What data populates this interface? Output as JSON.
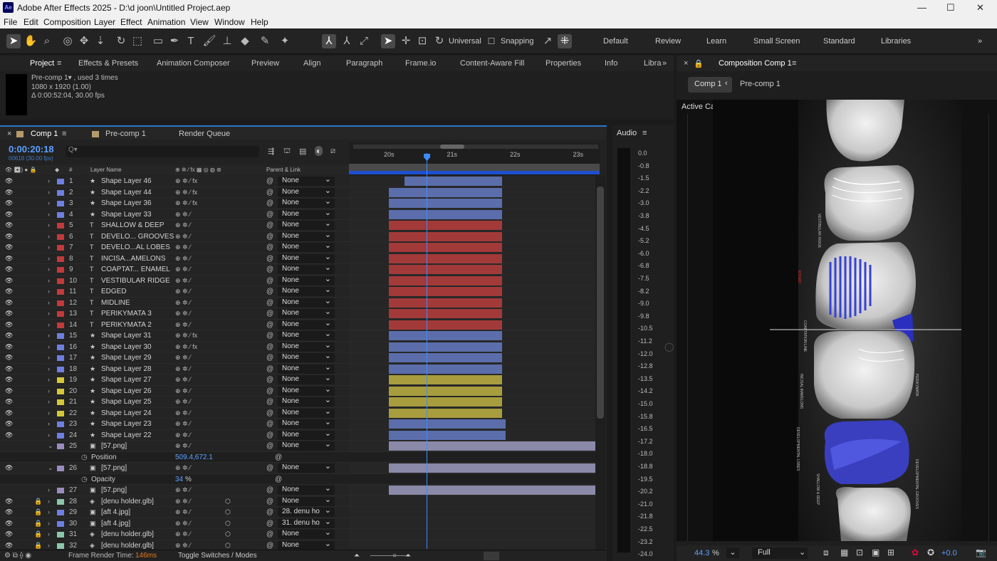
{
  "window": {
    "title": "Adobe After Effects 2025 - D:\\d joon\\Untitled Project.aep",
    "app_icon": "Ae",
    "controls": [
      "—",
      "☐",
      "✕"
    ]
  },
  "menu": [
    "File",
    "Edit",
    "Composition",
    "Layer",
    "Effect",
    "Animation",
    "View",
    "Window",
    "Help"
  ],
  "toolbar": {
    "axis_label": "Universal",
    "snapping_label": "Snapping",
    "workspaces": [
      "Default",
      "Review",
      "Learn",
      "Small Screen",
      "Standard",
      "Libraries"
    ]
  },
  "panel_tabs": [
    "Project",
    "Effects & Presets",
    "Animation Composer",
    "Preview",
    "Align",
    "Paragraph",
    "Frame.io",
    "Content-Aware Fill",
    "Properties",
    "Info",
    "Libra"
  ],
  "project": {
    "item_name": "Pre-comp 1▾ , used 3 times",
    "size": "1080 x 1920 (1.00)",
    "duration": "Δ 0:00:52:04, 30.00 fps"
  },
  "timeline": {
    "tabs": [
      "Comp 1",
      "Pre-comp 1",
      "Render Queue"
    ],
    "timecode": "0:00:20:18",
    "timecode_sub": "00618 (30.00 fps)",
    "search_placeholder": "Q▾",
    "col_layer_name": "Layer Name",
    "col_parent": "Parent & Link",
    "col_hash": "#",
    "ruler_ticks": [
      "20s",
      "21s",
      "22s",
      "23s"
    ],
    "playhead_time_s": 20.6,
    "frame_render_time_label": "Frame Render Time:",
    "frame_render_time_value": "146ms",
    "toggle_label": "Toggle Switches / Modes"
  },
  "colors": {
    "blue_label": "#6e7fe0",
    "red_label": "#c23a3a",
    "yellow_label": "#d6c73a",
    "purple_label": "#9a8cbf",
    "mint_label": "#8ac7ac",
    "blue_bar": "#5b6eab",
    "red_bar": "#a33a3a",
    "yellow_bar": "#a89d3e",
    "lav_bar": "#8b89a8",
    "accent": "#2d74c8"
  },
  "layers": [
    {
      "num": "1",
      "type": "★",
      "name": "Shape Layer 46",
      "label": "blue",
      "parent": "None",
      "fx": true,
      "bar": "blue",
      "bar_start": 20.25,
      "bar_end": 21.8
    },
    {
      "num": "2",
      "type": "★",
      "name": "Shape Layer 44",
      "label": "blue",
      "parent": "None",
      "fx": true,
      "bar": "blue",
      "bar_start": 20.0,
      "bar_end": 21.8
    },
    {
      "num": "3",
      "type": "★",
      "name": "Shape Layer 36",
      "label": "blue",
      "parent": "None",
      "fx": true,
      "bar": "blue",
      "bar_start": 20.0,
      "bar_end": 21.8
    },
    {
      "num": "4",
      "type": "★",
      "name": "Shape Layer 33",
      "label": "blue",
      "parent": "None",
      "fx": false,
      "bar": "blue",
      "bar_start": 20.0,
      "bar_end": 21.8
    },
    {
      "num": "5",
      "type": "T",
      "name": "SHALLOW & DEEP",
      "label": "red",
      "parent": "None",
      "fx": false,
      "bar": "red",
      "bar_start": 20.0,
      "bar_end": 21.8
    },
    {
      "num": "6",
      "type": "T",
      "name": "DEVELO... GROOVES",
      "label": "red",
      "parent": "None",
      "fx": false,
      "bar": "red",
      "bar_start": 20.0,
      "bar_end": 21.8
    },
    {
      "num": "7",
      "type": "T",
      "name": "DEVELO...AL  LOBES",
      "label": "red",
      "parent": "None",
      "fx": false,
      "bar": "red",
      "bar_start": 20.0,
      "bar_end": 21.8
    },
    {
      "num": "8",
      "type": "T",
      "name": "INCISA...AMELONS",
      "label": "red",
      "parent": "None",
      "fx": false,
      "bar": "red",
      "bar_start": 20.0,
      "bar_end": 21.8
    },
    {
      "num": "9",
      "type": "T",
      "name": "COAPTAT...  ENAMEL",
      "label": "red",
      "parent": "None",
      "fx": false,
      "bar": "red",
      "bar_start": 20.0,
      "bar_end": 21.8
    },
    {
      "num": "10",
      "type": "T",
      "name": "VESTIBULAR  RIDGE",
      "label": "red",
      "parent": "None",
      "fx": false,
      "bar": "red",
      "bar_start": 20.0,
      "bar_end": 21.8
    },
    {
      "num": "11",
      "type": "T",
      "name": "EDGED",
      "label": "red",
      "parent": "None",
      "fx": false,
      "bar": "red",
      "bar_start": 20.0,
      "bar_end": 21.8
    },
    {
      "num": "12",
      "type": "T",
      "name": "MIDLINE",
      "label": "red",
      "parent": "None",
      "fx": false,
      "bar": "red",
      "bar_start": 20.0,
      "bar_end": 21.8
    },
    {
      "num": "13",
      "type": "T",
      "name": "PERIKYMATA 3",
      "label": "red",
      "parent": "None",
      "fx": false,
      "bar": "red",
      "bar_start": 20.0,
      "bar_end": 21.8
    },
    {
      "num": "14",
      "type": "T",
      "name": "PERIKYMATA 2",
      "label": "red",
      "parent": "None",
      "fx": false,
      "bar": "red",
      "bar_start": 20.0,
      "bar_end": 21.8
    },
    {
      "num": "15",
      "type": "★",
      "name": "Shape Layer 31",
      "label": "blue",
      "parent": "None",
      "fx": true,
      "bar": "blue",
      "bar_start": 20.0,
      "bar_end": 21.8
    },
    {
      "num": "16",
      "type": "★",
      "name": "Shape Layer 30",
      "label": "blue",
      "parent": "None",
      "fx": true,
      "bar": "blue",
      "bar_start": 20.0,
      "bar_end": 21.8
    },
    {
      "num": "17",
      "type": "★",
      "name": "Shape Layer 29",
      "label": "blue",
      "parent": "None",
      "fx": false,
      "bar": "blue",
      "bar_start": 20.0,
      "bar_end": 21.8
    },
    {
      "num": "18",
      "type": "★",
      "name": "Shape Layer 28",
      "label": "blue",
      "parent": "None",
      "fx": false,
      "bar": "blue",
      "bar_start": 20.0,
      "bar_end": 21.8
    },
    {
      "num": "19",
      "type": "★",
      "name": "Shape Layer 27",
      "label": "yellow",
      "parent": "None",
      "fx": false,
      "bar": "yellow",
      "bar_start": 20.0,
      "bar_end": 21.8
    },
    {
      "num": "20",
      "type": "★",
      "name": "Shape Layer 26",
      "label": "yellow",
      "parent": "None",
      "fx": false,
      "bar": "yellow",
      "bar_start": 20.0,
      "bar_end": 21.8
    },
    {
      "num": "21",
      "type": "★",
      "name": "Shape Layer 25",
      "label": "yellow",
      "parent": "None",
      "fx": false,
      "bar": "yellow",
      "bar_start": 20.0,
      "bar_end": 21.8
    },
    {
      "num": "22",
      "type": "★",
      "name": "Shape Layer 24",
      "label": "yellow",
      "parent": "None",
      "fx": false,
      "bar": "yellow",
      "bar_start": 20.0,
      "bar_end": 21.8
    },
    {
      "num": "23",
      "type": "★",
      "name": "Shape Layer 23",
      "label": "blue",
      "parent": "None",
      "fx": false,
      "bar": "blue",
      "bar_start": 20.0,
      "bar_end": 21.85
    },
    {
      "num": "24",
      "type": "★",
      "name": "Shape Layer 22",
      "label": "blue",
      "parent": "None",
      "fx": false,
      "bar": "blue",
      "bar_start": 20.0,
      "bar_end": 21.85
    },
    {
      "num": "25",
      "type": "▣",
      "name": "[57.png]",
      "label": "purple",
      "parent": "None",
      "fx": false,
      "bar": "lav",
      "bar_start": 20.0,
      "bar_end": 23.4,
      "expanded": true,
      "prop": {
        "name": "Position",
        "value": "509.4,672.1"
      }
    },
    {
      "num": "26",
      "type": "▣",
      "name": "[57.png]",
      "label": "purple",
      "parent": "None",
      "fx": false,
      "bar": "lav",
      "bar_start": 20.0,
      "bar_end": 23.4,
      "expanded": true,
      "prop": {
        "name": "Opacity",
        "value": "34",
        "unit": "%"
      }
    },
    {
      "num": "27",
      "type": "▣",
      "name": "[57.png]",
      "label": "purple",
      "parent": "None",
      "fx": false,
      "bar": "lav",
      "bar_start": 20.0,
      "bar_end": 23.4
    },
    {
      "num": "28",
      "type": "◈",
      "name": "[denu holder.glb]",
      "label": "mint",
      "parent": "None",
      "fx": false,
      "bar": "none"
    },
    {
      "num": "29",
      "type": "▣",
      "name": "[aft 4.jpg]",
      "label": "blue",
      "parent": "28. denu ho",
      "fx": false,
      "bar": "none"
    },
    {
      "num": "30",
      "type": "▣",
      "name": "[aft 4.jpg]",
      "label": "blue",
      "parent": "31. denu ho",
      "fx": false,
      "bar": "none"
    },
    {
      "num": "31",
      "type": "◈",
      "name": "[denu holder.glb]",
      "label": "mint",
      "parent": "None",
      "fx": false,
      "bar": "none"
    },
    {
      "num": "32",
      "type": "◈",
      "name": "[denu holder.glb]",
      "label": "mint",
      "parent": "None",
      "fx": false,
      "bar": "none"
    }
  ],
  "audio": {
    "title": "Audio",
    "levels": [
      "0.0",
      "-0.8",
      "-1.5",
      "-2.2",
      "-3.0",
      "-3.8",
      "-4.5",
      "-5.2",
      "-6.0",
      "-6.8",
      "-7.5",
      "-8.2",
      "-9.0",
      "-9.8",
      "-10.5",
      "-11.2",
      "-12.0",
      "-12.8",
      "-13.5",
      "-14.2",
      "-15.0",
      "-15.8",
      "-16.5",
      "-17.2",
      "-18.0",
      "-18.8",
      "-19.5",
      "-20.2",
      "-21.0",
      "-21.8",
      "-22.5",
      "-23.2",
      "-24.0"
    ]
  },
  "composition": {
    "title": "Composition Comp 1",
    "nav": [
      "Comp 1",
      "Pre-comp 1"
    ],
    "camera": "Active Camera (Default)",
    "zoom": "44.3",
    "zoom_unit": "%",
    "resolution": "Full",
    "exposure": "+0.0"
  }
}
